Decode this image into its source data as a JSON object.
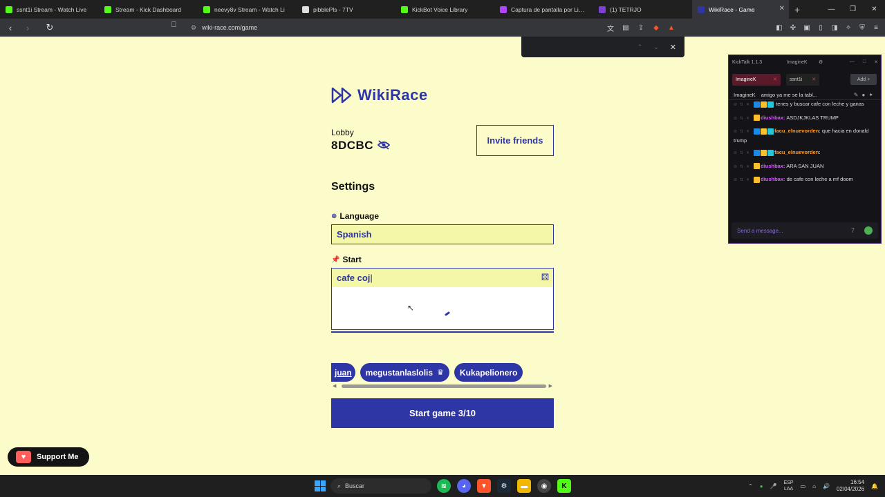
{
  "browser": {
    "tabs": [
      {
        "label": "ssnt1i Stream - Watch Live",
        "icon_color": "#53fc18",
        "icon": "kick-icon"
      },
      {
        "label": "Stream - Kick Dashboard",
        "icon_color": "#53fc18",
        "icon": "kick-icon"
      },
      {
        "label": "neevy8v Stream - Watch Li",
        "icon_color": "#53fc18",
        "icon": "kick-icon"
      },
      {
        "label": "pibblePls - 7TV",
        "icon_color": "#dddddd",
        "icon": "7tv-icon"
      },
      {
        "label": "KickBot Voice Library",
        "icon_color": "#53fc18",
        "icon": "kickbot-icon"
      },
      {
        "label": "Captura de pantalla por Lightsh",
        "icon_color": "#b044ff",
        "icon": "lightshot-icon"
      },
      {
        "label": "(1) TETRJO",
        "icon_color": "#7e3fd6",
        "icon": "tetrio-icon"
      },
      {
        "label": "WikiRace - Game",
        "icon_color": "#2e35a5",
        "icon": "wikirace-icon",
        "active": true
      }
    ],
    "url": "wiki-race.com/game"
  },
  "app": {
    "title": "WikiRace",
    "lobby_label": "Lobby",
    "lobby_code": "8DCBC",
    "invite_label": "Invite friends",
    "settings_title": "Settings",
    "language_label": "Language",
    "language_value": "Spanish",
    "start_label": "Start",
    "start_value": "cafe coj",
    "players": [
      {
        "name": "juan",
        "host": false
      },
      {
        "name": "megustanlaslolis",
        "host": true
      },
      {
        "name": "Kukapelionero",
        "host": false
      }
    ],
    "start_button": "Start game 3/10",
    "support_label": "Support Me",
    "accent": "#2e35a5",
    "background": "#fcfcca"
  },
  "kicktalk": {
    "title": "KickTalk 1.1.3",
    "user": "ImagineK",
    "tabs": [
      {
        "label": "ImagineK",
        "active": true
      },
      {
        "label": "ssnt1i",
        "active": false
      }
    ],
    "add_label": "Add",
    "pinned_user": "ImagineK",
    "pinned_text": "amigo ya me se la tabl...",
    "messages": [
      {
        "name": "",
        "text": "tenes y buscar cafe con leche y ganas",
        "color": "orange",
        "badges": [
          "#1e88e5",
          "#fbc02d",
          "#26c6da"
        ]
      },
      {
        "name": "diushbax:",
        "text": "ASDJKJKLAS TRUMP",
        "color": "pink",
        "badges": [
          "#fbc02d"
        ]
      },
      {
        "name": "facu_elnuevorden:",
        "text": "que hacia en donald trump",
        "color": "orange",
        "badges": [
          "#1e88e5",
          "#fbc02d",
          "#26c6da"
        ]
      },
      {
        "name": "facu_elnuevorden:",
        "text": "",
        "color": "orange",
        "badges": [
          "#1e88e5",
          "#fbc02d",
          "#26c6da"
        ]
      },
      {
        "name": "diushbax:",
        "text": "ARA SAN JUAN",
        "color": "pink",
        "badges": [
          "#fbc02d"
        ]
      },
      {
        "name": "diushbax:",
        "text": "de cafe con leche a mf doom",
        "color": "pink",
        "badges": [
          "#fbc02d"
        ]
      }
    ],
    "input_placeholder": "Send a message..."
  },
  "taskbar": {
    "search_placeholder": "Buscar",
    "lang_top": "ESP",
    "lang_bottom": "LAA",
    "time": "16:54",
    "date": "02/04/2026"
  }
}
